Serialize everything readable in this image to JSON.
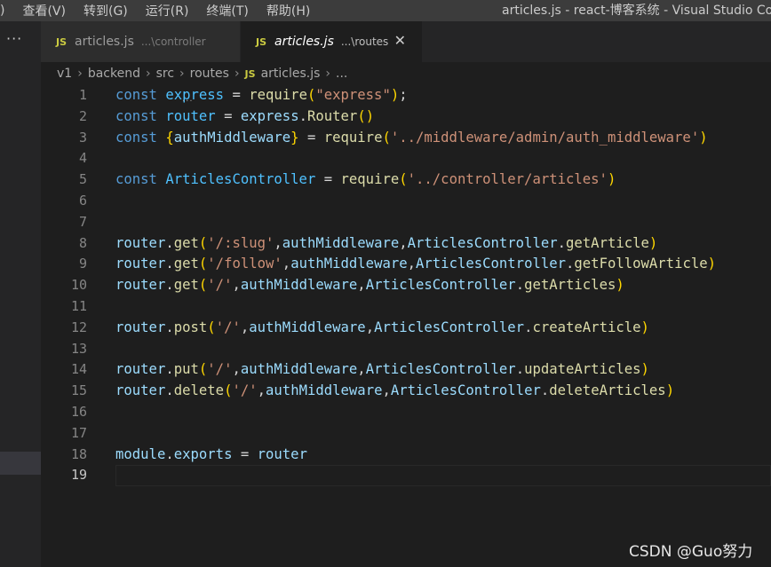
{
  "menu": {
    "items": [
      ")",
      "查看(V)",
      "转到(G)",
      "运行(R)",
      "终端(T)",
      "帮助(H)"
    ]
  },
  "window_title": "articles.js - react-博客系统 - Visual Studio Code",
  "activity": {
    "more": "···"
  },
  "tabs": [
    {
      "icon": "JS",
      "name": "articles.js",
      "desc": "...\\controller",
      "active": false
    },
    {
      "icon": "JS",
      "name": "articles.js",
      "desc": "...\\routes",
      "active": true,
      "close": "✕"
    }
  ],
  "breadcrumb": {
    "parts": [
      "v1",
      "backend",
      "src",
      "routes"
    ],
    "file_icon": "JS",
    "file": "articles.js",
    "tail": "..."
  },
  "editor": {
    "current_line": 19,
    "lines": [
      [
        [
          "kw",
          "const "
        ],
        [
          "var",
          "express"
        ],
        [
          "",
          "  = "
        ],
        [
          "fn",
          "require"
        ],
        [
          "p1",
          "("
        ],
        [
          "str",
          "\"express\""
        ],
        [
          "p1",
          ")"
        ],
        [
          "",
          ";"
        ]
      ],
      [
        [
          "kw",
          "const "
        ],
        [
          "var",
          "router"
        ],
        [
          "",
          ""
        ],
        [
          "",
          " = "
        ],
        [
          "prop",
          "express"
        ],
        [
          "",
          "."
        ],
        [
          "fn",
          "Router"
        ],
        [
          "p1",
          "()"
        ]
      ],
      [
        [
          "kw",
          "const "
        ],
        [
          "p1",
          "{"
        ],
        [
          "prop",
          "authMiddleware"
        ],
        [
          "p1",
          "}"
        ],
        [
          "",
          " = "
        ],
        [
          "fn",
          "require"
        ],
        [
          "p1",
          "("
        ],
        [
          "str",
          "'../middleware/admin/auth_middleware'"
        ],
        [
          "p1",
          ")"
        ]
      ],
      [],
      [
        [
          "kw",
          "const "
        ],
        [
          "var",
          "ArticlesController"
        ],
        [
          "",
          " = "
        ],
        [
          "fn",
          "require"
        ],
        [
          "p1",
          "("
        ],
        [
          "str",
          "'../controller/articles'"
        ],
        [
          "p1",
          ")"
        ]
      ],
      [],
      [],
      [
        [
          "prop",
          "router"
        ],
        [
          "",
          "."
        ],
        [
          "fn",
          "get"
        ],
        [
          "p1",
          "("
        ],
        [
          "str",
          "'/:slug'"
        ],
        [
          "",
          ","
        ],
        [
          "prop",
          "authMiddleware"
        ],
        [
          "",
          ","
        ],
        [
          "prop",
          "ArticlesController"
        ],
        [
          "",
          "."
        ],
        [
          "fn",
          "getArticle"
        ],
        [
          "p1",
          ")"
        ]
      ],
      [
        [
          "prop",
          "router"
        ],
        [
          "",
          "."
        ],
        [
          "fn",
          "get"
        ],
        [
          "p1",
          "("
        ],
        [
          "str",
          "'/follow'"
        ],
        [
          "",
          ","
        ],
        [
          "prop",
          "authMiddleware"
        ],
        [
          "",
          ","
        ],
        [
          "prop",
          "ArticlesController"
        ],
        [
          "",
          "."
        ],
        [
          "fn",
          "getFollowArticle"
        ],
        [
          "p1",
          ")"
        ]
      ],
      [
        [
          "prop",
          "router"
        ],
        [
          "",
          "."
        ],
        [
          "fn",
          "get"
        ],
        [
          "p1",
          "("
        ],
        [
          "str",
          "'/'"
        ],
        [
          "",
          ","
        ],
        [
          "prop",
          "authMiddleware"
        ],
        [
          "",
          ","
        ],
        [
          "prop",
          "ArticlesController"
        ],
        [
          "",
          "."
        ],
        [
          "fn",
          "getArticles"
        ],
        [
          "p1",
          ")"
        ]
      ],
      [],
      [
        [
          "prop",
          "router"
        ],
        [
          "",
          "."
        ],
        [
          "fn",
          "post"
        ],
        [
          "p1",
          "("
        ],
        [
          "str",
          "'/'"
        ],
        [
          "",
          ","
        ],
        [
          "prop",
          "authMiddleware"
        ],
        [
          "",
          ","
        ],
        [
          "prop",
          "ArticlesController"
        ],
        [
          "",
          "."
        ],
        [
          "fn",
          "createArticle"
        ],
        [
          "p1",
          ")"
        ]
      ],
      [],
      [
        [
          "prop",
          "router"
        ],
        [
          "",
          "."
        ],
        [
          "fn",
          "put"
        ],
        [
          "p1",
          "("
        ],
        [
          "str",
          "'/'"
        ],
        [
          "",
          ","
        ],
        [
          "prop",
          "authMiddleware"
        ],
        [
          "",
          ","
        ],
        [
          "prop",
          "ArticlesController"
        ],
        [
          "",
          "."
        ],
        [
          "fn",
          "updateArticles"
        ],
        [
          "p1",
          ")"
        ]
      ],
      [
        [
          "prop",
          "router"
        ],
        [
          "",
          "."
        ],
        [
          "fn",
          "delete"
        ],
        [
          "p1",
          "("
        ],
        [
          "str",
          "'/'"
        ],
        [
          "",
          ","
        ],
        [
          "prop",
          "authMiddleware"
        ],
        [
          "",
          ","
        ],
        [
          "prop",
          "ArticlesController"
        ],
        [
          "",
          "."
        ],
        [
          "fn",
          "deleteArticles"
        ],
        [
          "p1",
          ")"
        ]
      ],
      [],
      [],
      [
        [
          "prop",
          "module"
        ],
        [
          "",
          "."
        ],
        [
          "prop",
          "exports"
        ],
        [
          "",
          " = "
        ],
        [
          "prop",
          "router"
        ]
      ],
      []
    ]
  },
  "watermark": "CSDN @Guo努力",
  "colors": {
    "keyword": "#569cd6",
    "constant": "#4fc1ff",
    "property": "#9cdcfe",
    "function": "#dcdcaa",
    "string": "#ce9178",
    "bracket": "#ffd700",
    "js_icon": "#cbcb41",
    "background": "#1e1e1e"
  }
}
